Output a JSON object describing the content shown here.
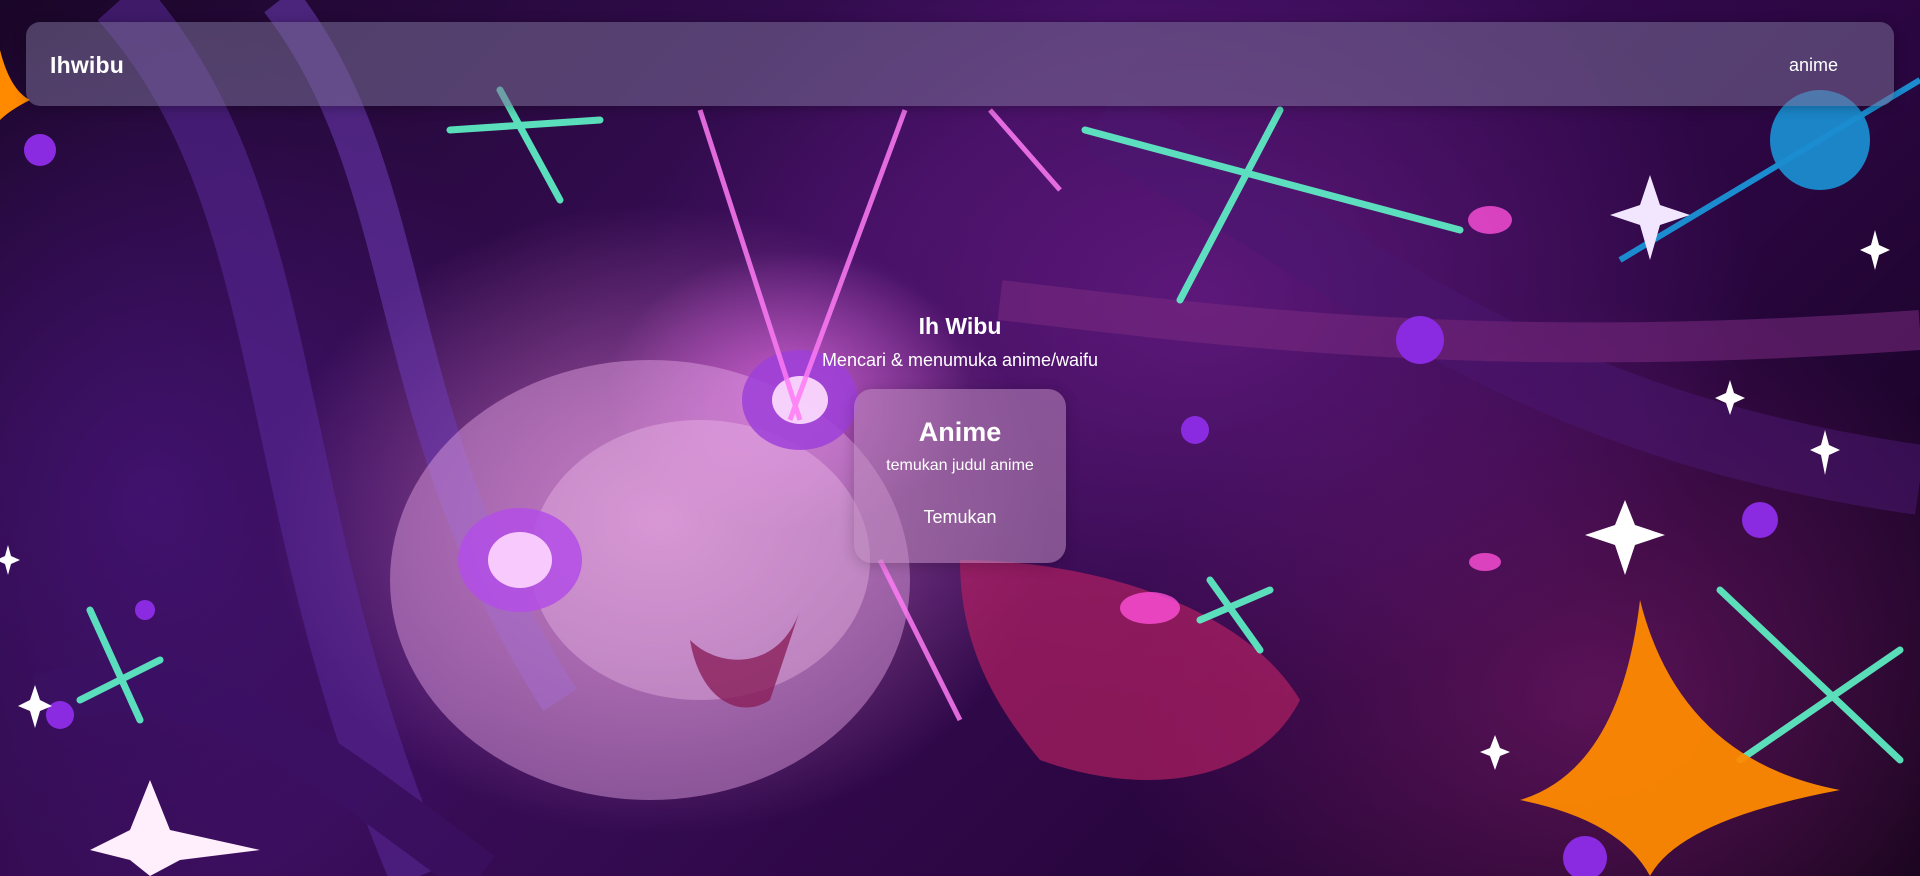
{
  "navbar": {
    "brand": "Ihwibu",
    "links": [
      "anime"
    ]
  },
  "hero": {
    "title": "Ih Wibu",
    "subtitle": "Mencari & menumuka anime/waifu"
  },
  "card": {
    "title": "Anime",
    "description": "temukan judul anime",
    "button_label": "Temukan"
  },
  "background": {
    "description_icon": "anime-girl-background-illustration",
    "accent_colors": [
      "#8a2be2",
      "#ff4fd8",
      "#5ff5c8",
      "#ff8a00",
      "#1a8ccf"
    ]
  }
}
